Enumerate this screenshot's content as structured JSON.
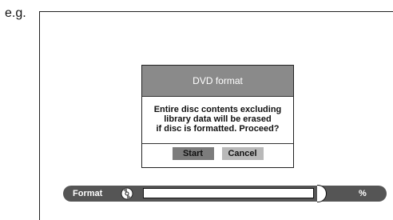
{
  "example_label": "e.g.",
  "dialog": {
    "title": "DVD format",
    "message_lines": [
      "Entire disc contents excluding",
      "library data will be erased",
      "if disc is formatted. Proceed?"
    ],
    "buttons": {
      "start": "Start",
      "cancel": "Cancel"
    }
  },
  "format_bar": {
    "label": "Format",
    "icon": "disc-icon",
    "progress_fraction": 0,
    "percent_text": "%"
  },
  "colors": {
    "title_bar": "#8a8a8a",
    "start_button": "#7c7c7c",
    "cancel_button": "#b9b9b9",
    "format_bar": "#555555"
  }
}
